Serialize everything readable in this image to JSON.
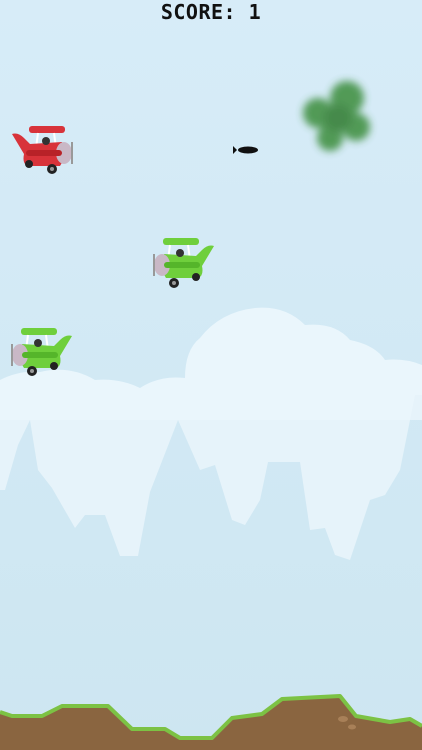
{
  "hud": {
    "score_label": "SCORE:",
    "score_value": "1"
  },
  "colors": {
    "sky_top": "#d6ecf8",
    "sky_bottom": "#cfe7f2",
    "cloud": "#eaf5fb",
    "player_plane": "#d8333a",
    "enemy_plane": "#6fcf3c",
    "ground_dirt": "#8a6540",
    "ground_grass": "#7fc34a",
    "smoke": "#3a8a3a"
  },
  "sprites": {
    "player": "red-biplane",
    "enemies": [
      "green-biplane",
      "green-biplane"
    ],
    "projectile": "bomb",
    "effect": "green-smoke-cloud"
  }
}
